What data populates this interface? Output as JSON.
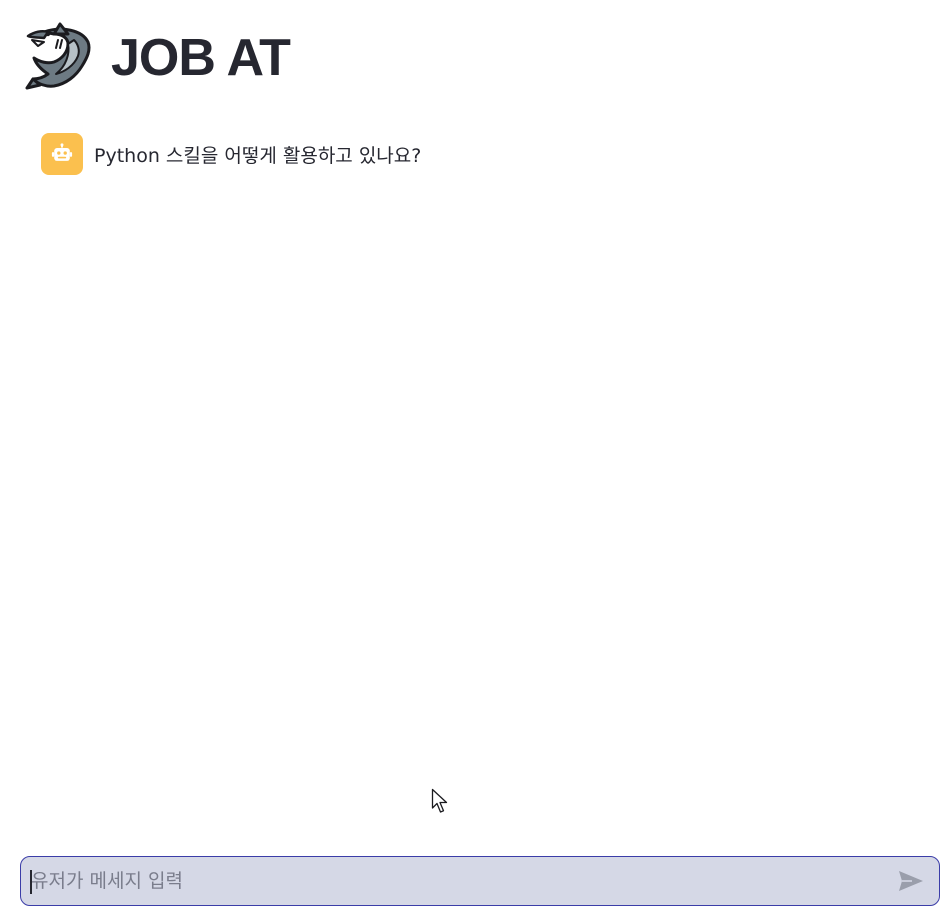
{
  "header": {
    "logo_icon": "shark-logo-icon",
    "title": "JOB AT"
  },
  "chat": {
    "messages": [
      {
        "role": "assistant",
        "avatar_icon": "robot-face-icon",
        "avatar_color": "#fbc04e",
        "text": "Python 스킬을 어떻게 활용하고 있나요?"
      }
    ]
  },
  "input": {
    "placeholder": "유저가 메세지 입력",
    "value": "",
    "send_icon": "send-arrow-icon",
    "border_color": "#3b3da8",
    "background_color": "#d5d8e6"
  }
}
